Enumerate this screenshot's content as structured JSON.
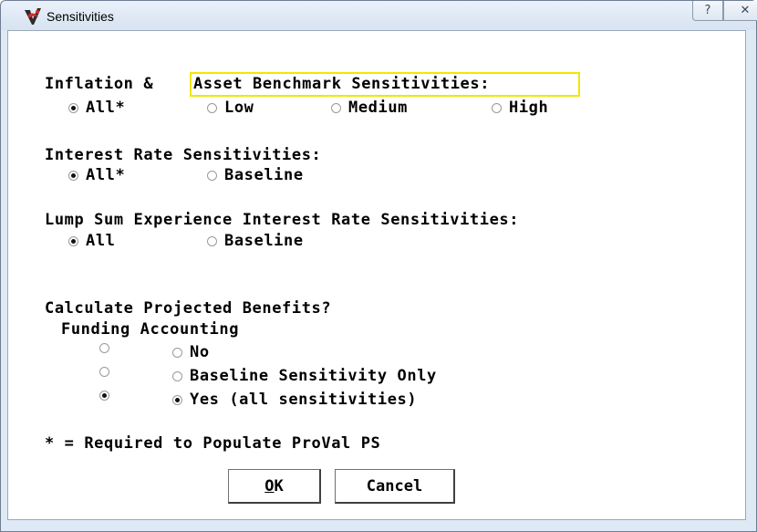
{
  "window": {
    "title": "Sensitivities",
    "help_glyph": "?",
    "close_glyph": "✕"
  },
  "inflation": {
    "label_prefix": "Inflation &",
    "label_highlight": "Asset Benchmark Sensitivities:",
    "options": [
      "All*",
      "Low",
      "Medium",
      "High"
    ],
    "selected": "All*"
  },
  "interest": {
    "label": "Interest Rate Sensitivities:",
    "options": [
      "All*",
      "Baseline"
    ],
    "selected": "All*"
  },
  "lump_sum": {
    "label": "Lump Sum Experience Interest Rate Sensitivities:",
    "options": [
      "All",
      "Baseline"
    ],
    "selected": "All"
  },
  "projected": {
    "question": "Calculate Projected Benefits?",
    "columns": "Funding Accounting",
    "rows": [
      {
        "label": "No",
        "funding_selected": false,
        "accounting_selected": false
      },
      {
        "label": "Baseline Sensitivity Only",
        "funding_selected": false,
        "accounting_selected": false
      },
      {
        "label": "Yes (all sensitivities)",
        "funding_selected": true,
        "accounting_selected": true
      }
    ]
  },
  "footnote": "* = Required to Populate ProVal PS",
  "buttons": {
    "ok_mnemonic": "O",
    "ok_rest": "K",
    "cancel": "Cancel"
  },
  "colors": {
    "highlight": "#f2e600",
    "window_frame": "#dfe9f5"
  }
}
